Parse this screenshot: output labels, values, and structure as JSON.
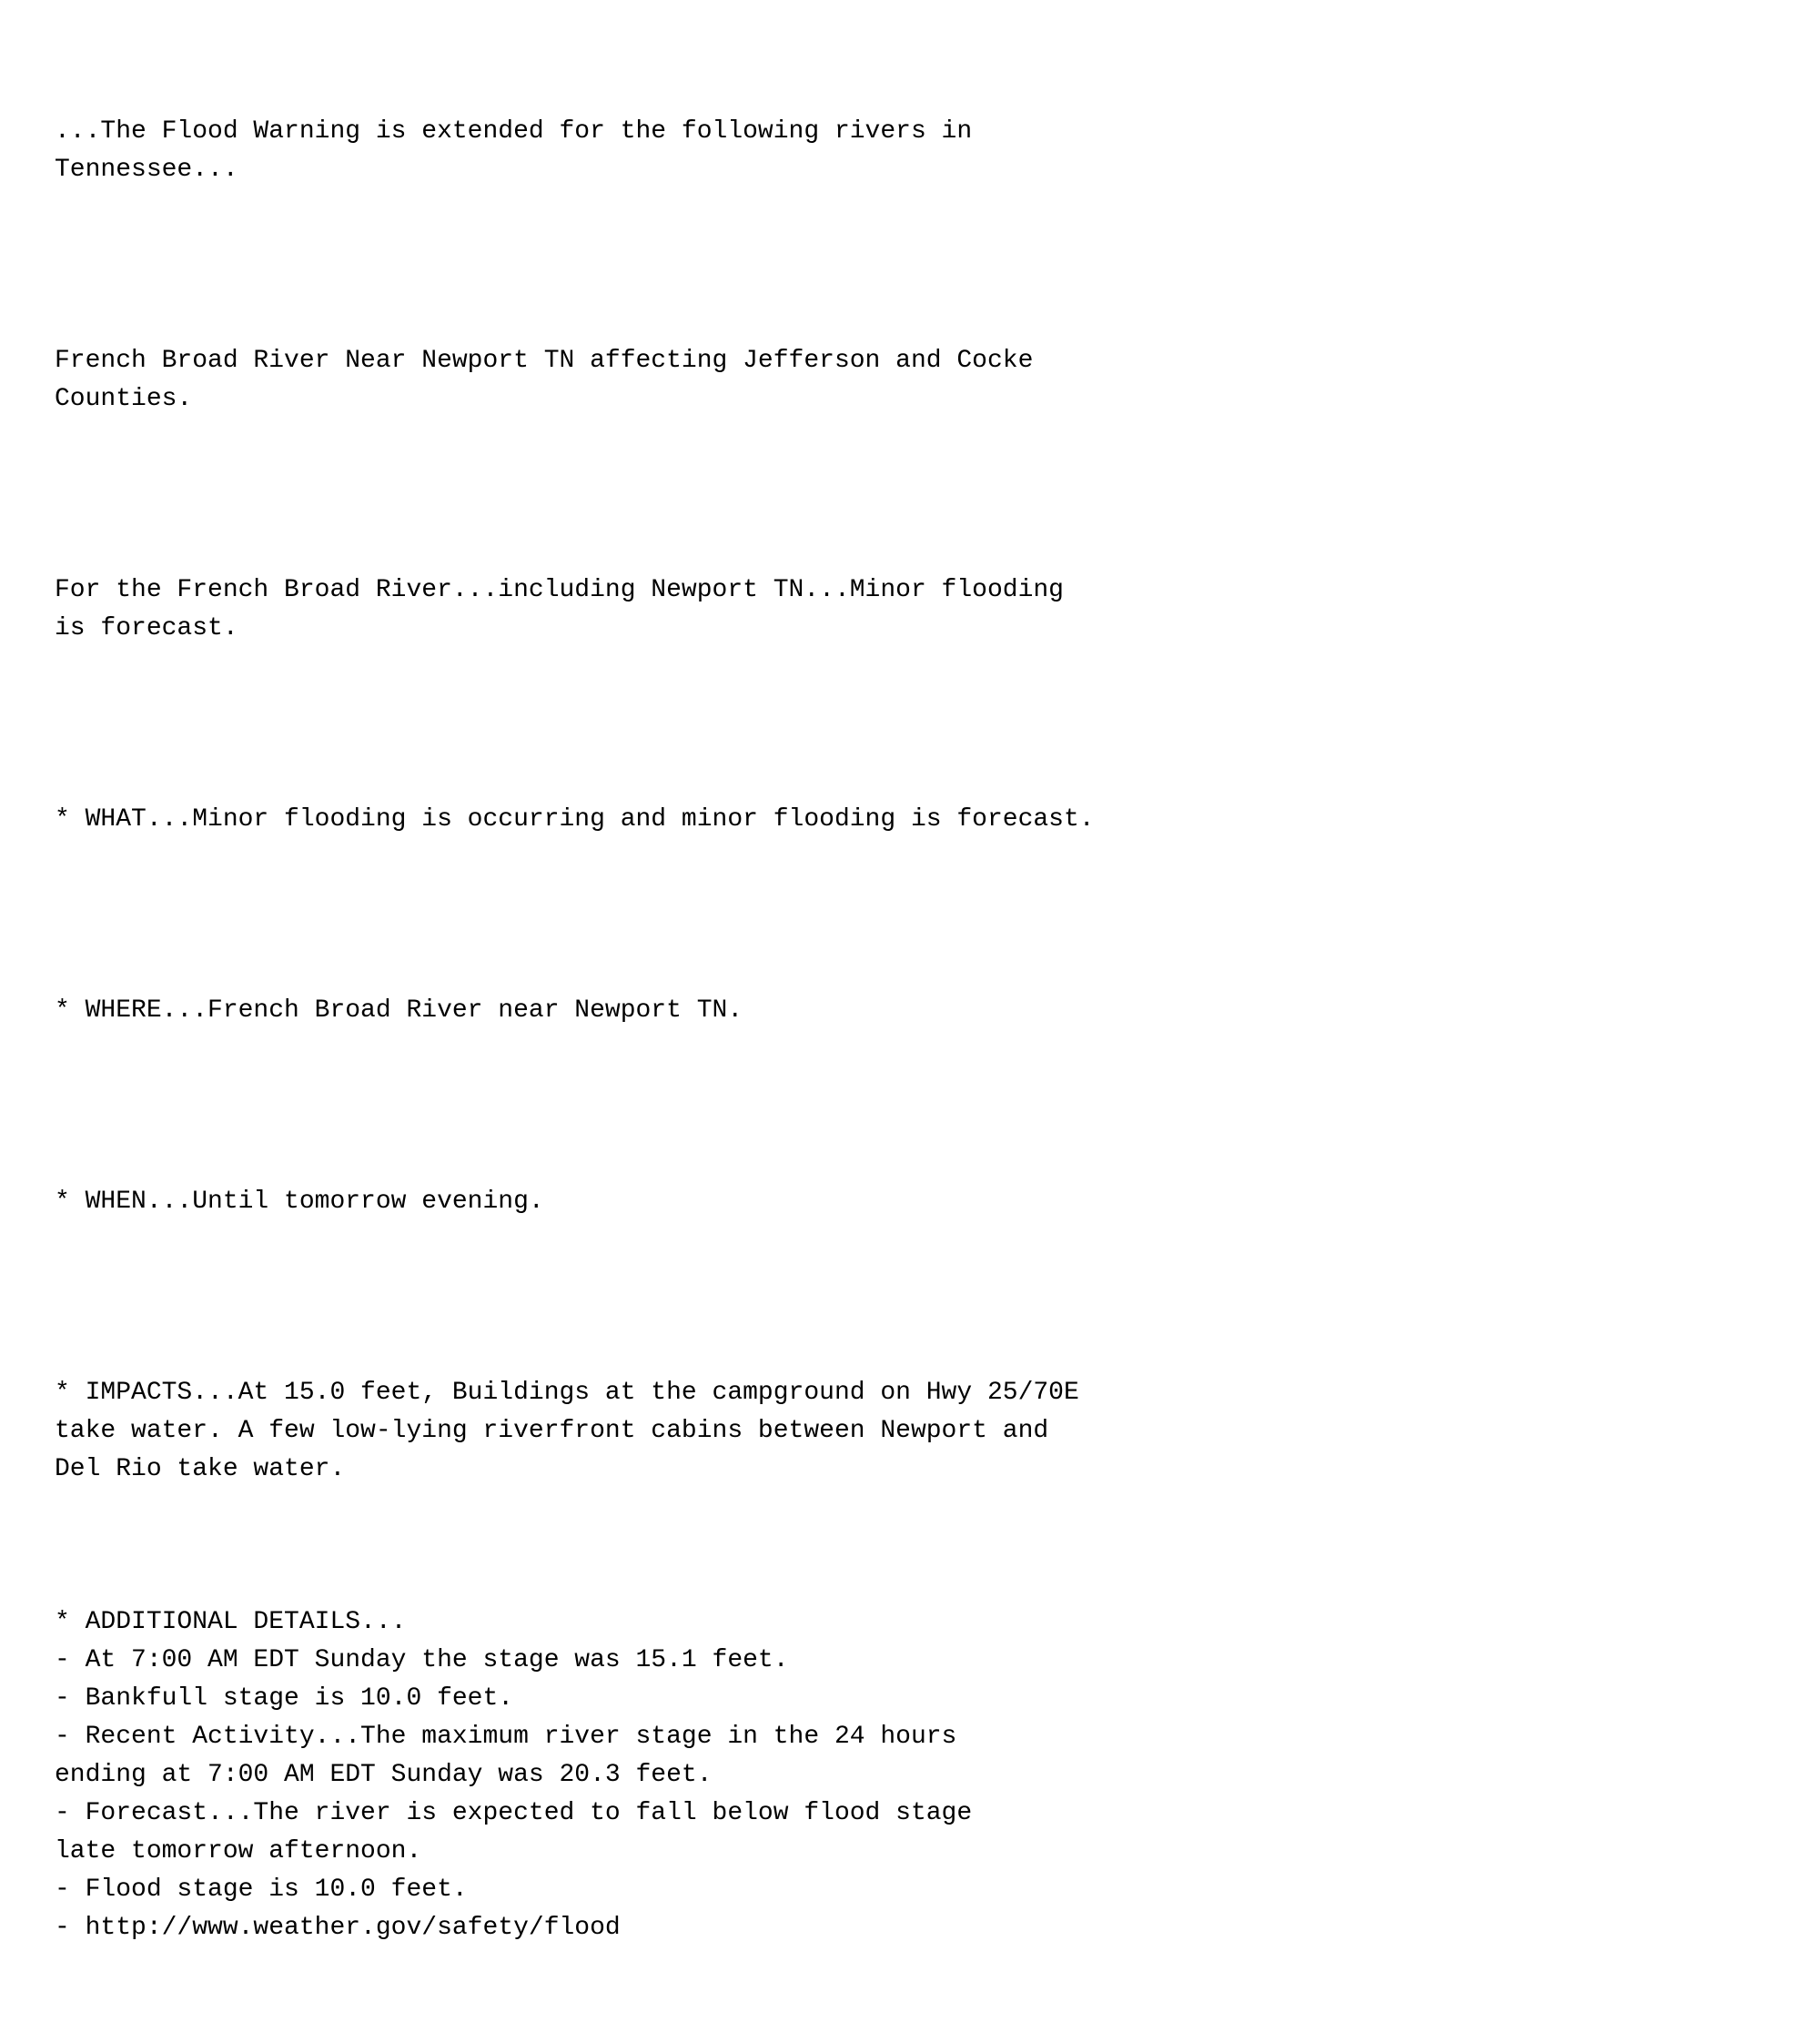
{
  "content": {
    "paragraphs": [
      {
        "id": "intro",
        "text": "...The Flood Warning is extended for the following rivers in\nTennessee..."
      },
      {
        "id": "location",
        "text": "French Broad River Near Newport TN affecting Jefferson and Cocke\nCounties."
      },
      {
        "id": "forecast-summary",
        "text": "For the French Broad River...including Newport TN...Minor flooding\nis forecast."
      },
      {
        "id": "what",
        "text": "* WHAT...Minor flooding is occurring and minor flooding is forecast."
      },
      {
        "id": "where",
        "text": "* WHERE...French Broad River near Newport TN."
      },
      {
        "id": "when",
        "text": "* WHEN...Until tomorrow evening."
      },
      {
        "id": "impacts",
        "text": "* IMPACTS...At 15.0 feet, Buildings at the campground on Hwy 25/70E\ntake water. A few low-lying riverfront cabins between Newport and\nDel Rio take water."
      },
      {
        "id": "additional-details",
        "text": "\n* ADDITIONAL DETAILS...\n- At 7:00 AM EDT Sunday the stage was 15.1 feet.\n- Bankfull stage is 10.0 feet.\n- Recent Activity...The maximum river stage in the 24 hours\nending at 7:00 AM EDT Sunday was 20.3 feet.\n- Forecast...The river is expected to fall below flood stage\nlate tomorrow afternoon.\n- Flood stage is 10.0 feet.\n- http://www.weather.gov/safety/flood"
      }
    ]
  }
}
